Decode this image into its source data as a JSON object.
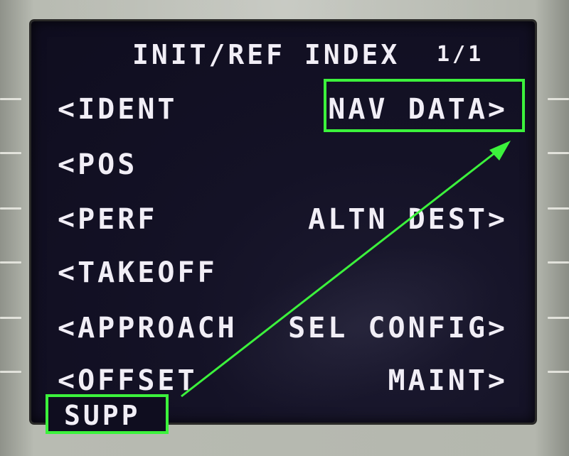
{
  "cdu": {
    "title": "INIT/REF INDEX",
    "page": "1/1",
    "left_items": [
      "<IDENT",
      "<POS",
      "<PERF",
      "<TAKEOFF",
      "<APPROACH",
      "<OFFSET"
    ],
    "right_items": [
      "NAV DATA>",
      "ALTN DEST>",
      "SEL CONFIG>",
      "MAINT>"
    ],
    "overlay_label": "SUPP"
  },
  "annotation": {
    "highlight_color": "#3cf23c"
  }
}
